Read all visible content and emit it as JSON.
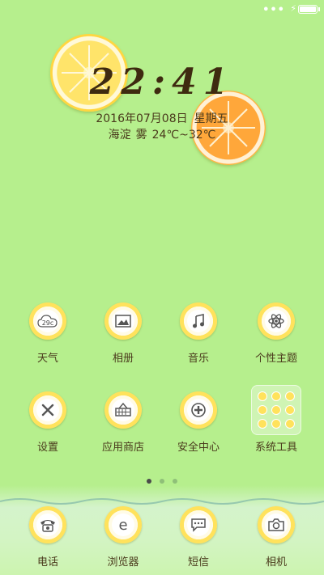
{
  "status_bar": {
    "signal": "•••",
    "charging_icon": "lightning-bolt",
    "battery_level_pct": 100
  },
  "clock": {
    "time": "22:41"
  },
  "date": {
    "date": "2016年07月08日",
    "weekday": "星期五"
  },
  "weather": {
    "location": "海淀",
    "condition": "雾",
    "temp_range": "24℃~32℃"
  },
  "apps_row1": [
    {
      "label": "天气",
      "icon": "weather-cloud-icon",
      "icon_text": "29c"
    },
    {
      "label": "相册",
      "icon": "gallery-icon"
    },
    {
      "label": "音乐",
      "icon": "music-note-icon"
    },
    {
      "label": "个性主题",
      "icon": "theme-atom-icon"
    }
  ],
  "apps_row2": [
    {
      "label": "设置",
      "icon": "settings-tools-icon"
    },
    {
      "label": "应用商店",
      "icon": "app-store-basket-icon"
    },
    {
      "label": "安全中心",
      "icon": "security-shield-icon"
    },
    {
      "label": "系统工具",
      "icon": "folder-icon"
    }
  ],
  "pager": {
    "pages": 3,
    "active_page": 1
  },
  "dock": [
    {
      "label": "电话",
      "icon": "phone-icon"
    },
    {
      "label": "浏览器",
      "icon": "browser-icon"
    },
    {
      "label": "短信",
      "icon": "message-icon"
    },
    {
      "label": "相机",
      "icon": "camera-icon"
    }
  ],
  "colors": {
    "background": "#b6ef8d",
    "text": "#4a3a1c",
    "lemon": "#ffe25c",
    "orange": "#ffa73a"
  }
}
